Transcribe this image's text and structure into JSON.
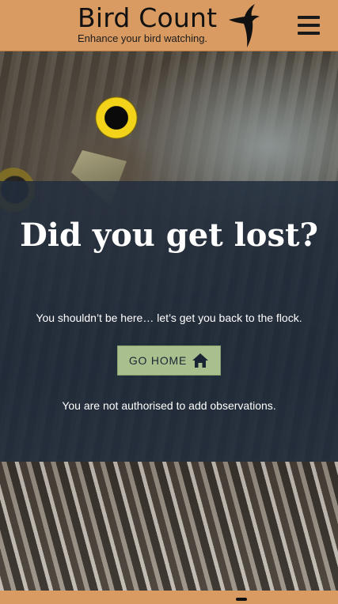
{
  "header": {
    "title": "Bird Count",
    "tagline": "Enhance your bird watching.",
    "logo_icon": "bird-silhouette-icon",
    "menu_icon": "hamburger-menu-icon"
  },
  "main": {
    "headline": "Did you get lost?",
    "subtext": "You shouldn’t be here… let’s get you back to the flock.",
    "button_label": "GO HOME",
    "button_icon": "home-icon",
    "notice": "You are not authorised to add observations."
  },
  "colors": {
    "header_bg": "#d99b62",
    "overlay_bg": "#222d3e",
    "button_bg": "#a9c08e",
    "button_text": "#1b2433"
  }
}
